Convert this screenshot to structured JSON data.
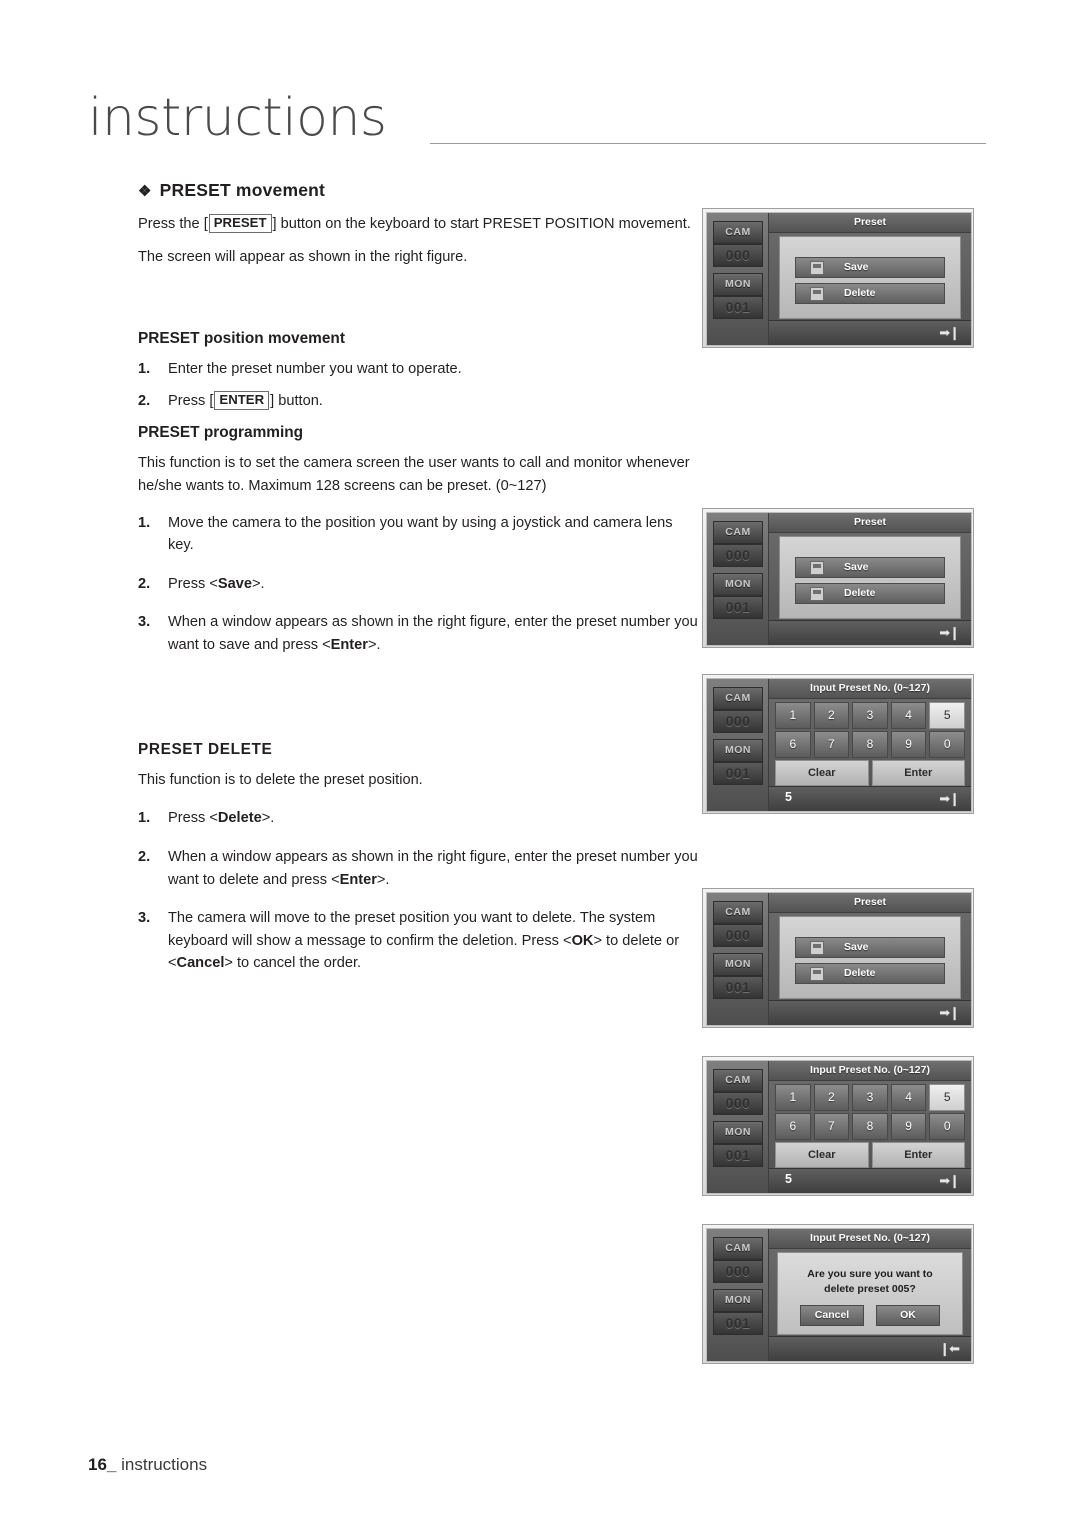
{
  "page": {
    "title": "instructions",
    "footer_page": "16_",
    "footer_label": "instructions"
  },
  "sections": {
    "preset_movement": {
      "heading": "PRESET movement",
      "bullet": "❖",
      "para1_a": "Press the [",
      "para1_key": "PRESET",
      "para1_b": "] button on the keyboard to start PRESET POSITION movement.",
      "para2": "The screen will appear as shown in the right figure."
    },
    "position_movement": {
      "heading": "PRESET position movement",
      "steps": [
        {
          "num": "1.",
          "text": "Enter the preset number you want to operate."
        },
        {
          "num": "2.",
          "pre": "Press [",
          "key": "ENTER",
          "post": "] button."
        }
      ]
    },
    "programming": {
      "heading": "PRESET programming",
      "para": "This function is to set the camera screen the user wants to call and monitor whenever he/she wants to. Maximum 128 screens can be preset. (0~127)",
      "steps": [
        {
          "num": "1.",
          "text": "Move the camera to the position you want by using a joystick and camera lens key."
        },
        {
          "num": "2.",
          "pre": "Press <",
          "key": "Save",
          "post": ">."
        },
        {
          "num": "3.",
          "pre": "When a window appears as shown in the right figure, enter the preset number you want to save and press <",
          "key": "Enter",
          "post": ">."
        }
      ]
    },
    "delete": {
      "heading": "PRESET DELETE",
      "para": "This function is to delete the preset position.",
      "steps": [
        {
          "num": "1.",
          "pre": "Press <",
          "key": "Delete",
          "post": ">."
        },
        {
          "num": "2.",
          "pre": "When a window appears as shown in the right figure, enter the preset number you want to delete and press <",
          "key": "Enter",
          "post": ">."
        },
        {
          "num": "3.",
          "pre": "The camera will move to the preset position you want to delete. The system keyboard will show a message to confirm the deletion. Press <",
          "key": "OK",
          "mid": "> to delete or <",
          "key2": "Cancel",
          "post": "> to cancel the order."
        }
      ]
    }
  },
  "figures": {
    "rail": {
      "cam_label": "CAM",
      "cam_value": "000",
      "mon_label": "MON",
      "mon_value": "001"
    },
    "preset_panel": {
      "title": "Preset",
      "save_label": "Save",
      "delete_label": "Delete",
      "save_icon": "floppy-disk-icon",
      "delete_icon": "trash-icon",
      "status_arrow": "arrow-right-icon"
    },
    "keypad": {
      "title": "Input Preset No. (0~127)",
      "row1": [
        "1",
        "2",
        "3",
        "4",
        "5"
      ],
      "row2": [
        "6",
        "7",
        "8",
        "9",
        "0"
      ],
      "selected_key": "5",
      "clear_label": "Clear",
      "enter_label": "Enter",
      "status_value": "5",
      "status_arrow": "arrow-right-icon"
    },
    "confirm": {
      "title": "Input Preset No. (0~127)",
      "message_line1": "Are you sure you want to",
      "message_line2": "delete preset 005?",
      "cancel_label": "Cancel",
      "ok_label": "OK",
      "status_arrow": "arrow-left-icon"
    }
  }
}
